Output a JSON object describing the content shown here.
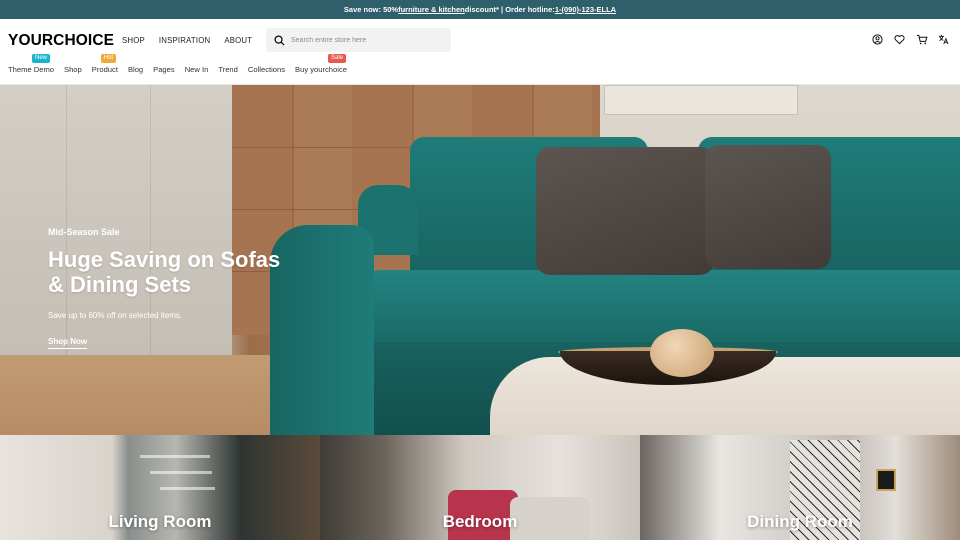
{
  "announcement": {
    "prefix": "Save now: 50% ",
    "link_text": "furniture & kitchen",
    "middle": " discount* | Order hotline: ",
    "phone": "1-(090)-123-ELLA"
  },
  "header": {
    "logo": "YOURCHOICE",
    "main_nav": [
      "SHOP",
      "INSPIRATION",
      "ABOUT"
    ],
    "search_placeholder": "Search entire store here"
  },
  "sub_nav": [
    {
      "label": "Theme Demo",
      "badge": "New",
      "badge_color": "#1bb4cf"
    },
    {
      "label": "Shop"
    },
    {
      "label": "Product",
      "badge": "Hot",
      "badge_color": "#f2a93b"
    },
    {
      "label": "Blog"
    },
    {
      "label": "Pages"
    },
    {
      "label": "New In"
    },
    {
      "label": "Trend"
    },
    {
      "label": "Collections"
    },
    {
      "label": "Buy yourchoice",
      "badge": "Sale",
      "badge_color": "#e8584f"
    }
  ],
  "hero": {
    "kicker": "Mid-Season Sale",
    "title": "Huge Saving on Sofas & Dining Sets",
    "subtitle": "Save up to 60% off on selected items.",
    "cta": "Shop Now"
  },
  "categories": [
    "Living Room",
    "Bedroom",
    "Dining Room"
  ],
  "colors": {
    "announcement_bg": "#2f5f6b",
    "sofa": "#1f7c79"
  },
  "icons": [
    "search-icon",
    "account-icon",
    "wishlist-icon",
    "cart-icon",
    "language-icon"
  ]
}
